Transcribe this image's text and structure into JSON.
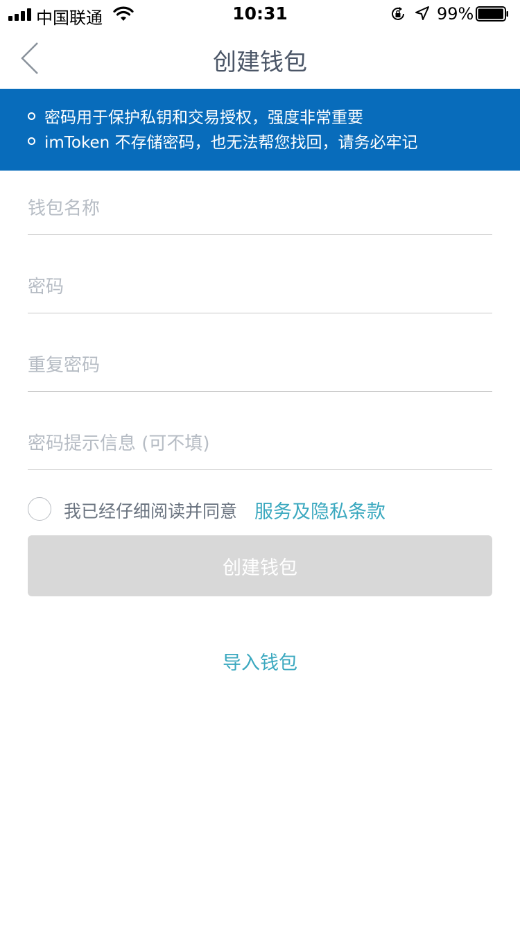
{
  "status_bar": {
    "carrier": "中国联通",
    "time": "10:31",
    "battery": "99%"
  },
  "nav": {
    "title": "创建钱包"
  },
  "notice": {
    "lines": [
      "密码用于保护私钥和交易授权，强度非常重要",
      "imToken 不存储密码，也无法帮您找回，请务必牢记"
    ]
  },
  "form": {
    "wallet_name_placeholder": "钱包名称",
    "password_placeholder": "密码",
    "repeat_password_placeholder": "重复密码",
    "hint_placeholder": "密码提示信息 (可不填)"
  },
  "agreement": {
    "checked": false,
    "text": "我已经仔细阅读并同意",
    "link": "服务及隐私条款"
  },
  "actions": {
    "create_label": "创建钱包",
    "import_label": "导入钱包"
  },
  "colors": {
    "banner": "#086cbb",
    "link": "#3aa8bf",
    "disabled_button": "#d8d8d8"
  }
}
